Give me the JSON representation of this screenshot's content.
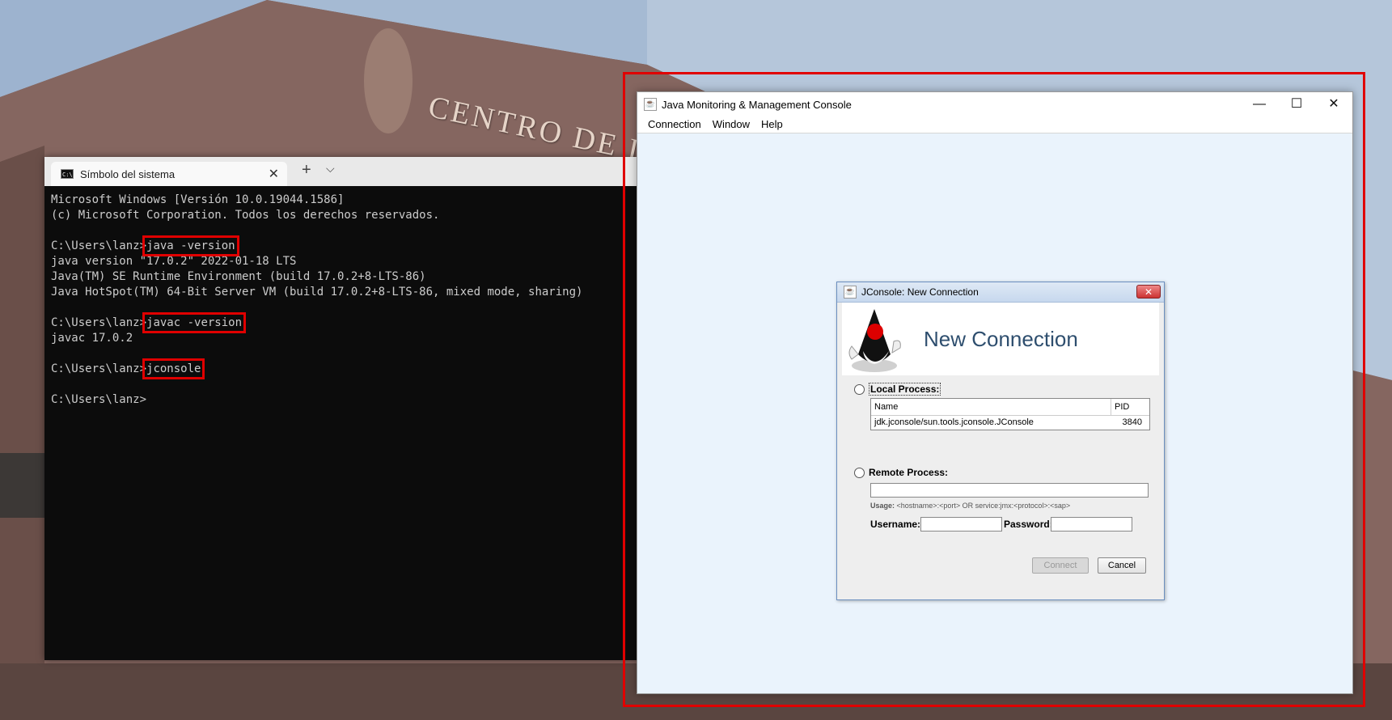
{
  "background": {
    "sign_text": "CENTRO DE IN"
  },
  "terminal": {
    "tab_title": "Símbolo del sistema",
    "tab_icon": "cmd-icon",
    "close_glyph": "✕",
    "new_tab_glyph": "+",
    "dropdown_glyph": "⌵",
    "lines": {
      "l1": "Microsoft Windows [Versión 10.0.19044.1586]",
      "l2": "(c) Microsoft Corporation. Todos los derechos reservados.",
      "prompt": "C:\\Users\\lanz>",
      "cmd1": "java -version",
      "o1": "java version \"17.0.2\" 2022-01-18 LTS",
      "o2": "Java(TM) SE Runtime Environment (build 17.0.2+8-LTS-86)",
      "o3": "Java HotSpot(TM) 64-Bit Server VM (build 17.0.2+8-LTS-86, mixed mode, sharing)",
      "cmd2": "javac -version",
      "o4": "javac 17.0.2",
      "cmd3": "jconsole"
    }
  },
  "jconsole": {
    "title": "Java Monitoring & Management Console",
    "minimize": "—",
    "maximize": "☐",
    "close": "✕",
    "menu": [
      "Connection",
      "Window",
      "Help"
    ]
  },
  "dialog": {
    "title": "JConsole: New Connection",
    "close": "✕",
    "heading": "New Connection",
    "local_label": "Local Process:",
    "table_headers": {
      "name": "Name",
      "pid": "PID"
    },
    "process": {
      "name": "jdk.jconsole/sun.tools.jconsole.JConsole",
      "pid": "3840"
    },
    "remote_label": "Remote Process:",
    "usage_label": "Usage:",
    "usage_text": "<hostname>:<port> OR service:jmx:<protocol>:<sap>",
    "username_label": "Username:",
    "password_label": "Password:",
    "connect": "Connect",
    "cancel": "Cancel"
  },
  "colors": {
    "highlight": "#e00000",
    "jconsole_bg": "#eaf3fc",
    "terminal_bg": "#0c0c0c"
  }
}
